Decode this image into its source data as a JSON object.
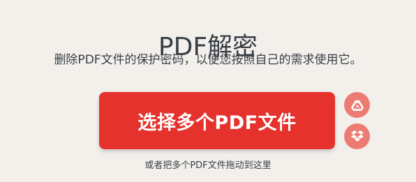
{
  "header": {
    "title": "PDF解密",
    "subtitle": "删除PDF文件的保护密码，以便您按照自己的需求使用它。"
  },
  "upload": {
    "select_button_label": "选择多个PDF文件",
    "drop_hint": "或者把多个PDF文件拖动到这里",
    "cloud_buttons": [
      {
        "icon": "google-drive-icon"
      },
      {
        "icon": "dropbox-icon"
      }
    ]
  },
  "colors": {
    "background": "#f3f0ec",
    "primary": "#e5322d",
    "cloud_button": "#ec7c73",
    "text": "#383e45"
  }
}
